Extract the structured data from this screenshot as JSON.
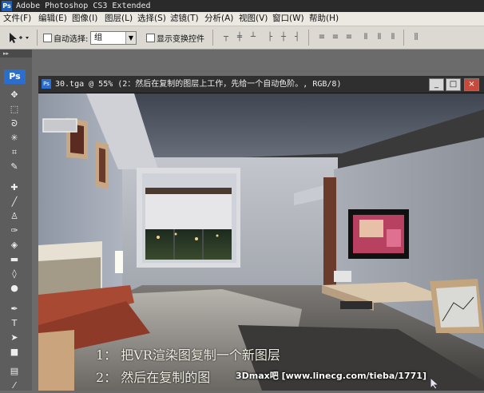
{
  "app": {
    "title": "Adobe Photoshop CS3 Extended",
    "logo": "Ps"
  },
  "menu": [
    "文件(F)",
    "编辑(E)",
    "图像(I)",
    "图层(L)",
    "选择(S)",
    "滤镜(T)",
    "分析(A)",
    "视图(V)",
    "窗口(W)",
    "帮助(H)"
  ],
  "options": {
    "auto_select_label": "自动选择:",
    "auto_select_value": "组",
    "show_transform_label": "显示变换控件"
  },
  "document": {
    "title": "30.tga @ 55% (2：然后在复制的图层上工作，先给一个自动色阶。, RGB/8)",
    "minimize": "_",
    "maximize": "□",
    "close": "×"
  },
  "caption": {
    "line1": "1：  把VR渲染图复制一个新图层",
    "line2": "2：  然后在复制的图"
  },
  "watermark": "3Dmax吧 [www.linecg.com/tieba/1771]",
  "toolbar": {
    "collapse": "▸▸"
  },
  "colors": {
    "titlebar": "#2a2a2a",
    "menubar": "#ece9e3",
    "optionbar": "#dcd9d2",
    "toolbar": "#5d5d5d",
    "ps_blue": "#2a6fcf"
  }
}
